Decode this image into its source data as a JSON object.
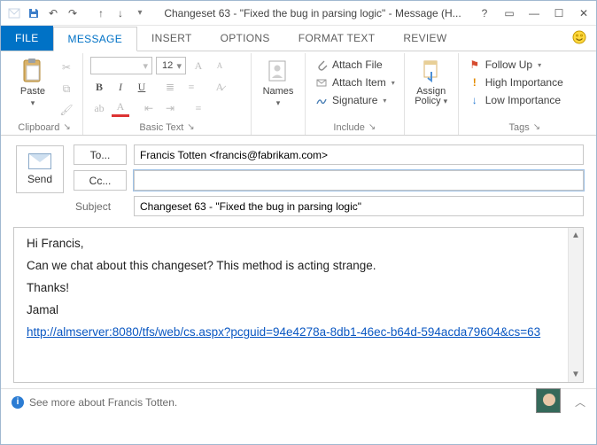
{
  "window": {
    "title": "Changeset 63 - \"Fixed the bug in parsing logic\" - Message (H..."
  },
  "qat": {
    "save": "save",
    "undo": "undo",
    "redo": "redo",
    "prev": "previous",
    "next": "next"
  },
  "tabs": {
    "file": "FILE",
    "message": "MESSAGE",
    "insert": "INSERT",
    "options": "OPTIONS",
    "format_text": "FORMAT TEXT",
    "review": "REVIEW"
  },
  "ribbon": {
    "clipboard": {
      "paste": "Paste",
      "label": "Clipboard"
    },
    "basic_text": {
      "font_size": "12",
      "label": "Basic Text"
    },
    "names": {
      "names": "Names"
    },
    "include": {
      "attach_file": "Attach File",
      "attach_item": "Attach Item",
      "signature": "Signature",
      "label": "Include"
    },
    "assign_policy": {
      "label1": "Assign",
      "label2": "Policy"
    },
    "tags": {
      "follow_up": "Follow Up",
      "high_importance": "High Importance",
      "low_importance": "Low Importance",
      "label": "Tags"
    }
  },
  "composer": {
    "send": "Send",
    "to_btn": "To...",
    "cc_btn": "Cc...",
    "subject_lbl": "Subject",
    "to_value": "Francis Totten <francis@fabrikam.com>",
    "cc_value": "",
    "subject_value": "Changeset 63 - \"Fixed the bug in parsing logic\""
  },
  "body": {
    "greeting": "Hi Francis,",
    "line1": "Can we chat about this changeset? This method is acting strange.",
    "thanks": "Thanks!",
    "sign": "Jamal",
    "link": "http://almserver:8080/tfs/web/cs.aspx?pcguid=94e4278a-8db1-46ec-b64d-594acda79604&cs=63"
  },
  "people_pane": {
    "text": "See more about Francis Totten."
  }
}
